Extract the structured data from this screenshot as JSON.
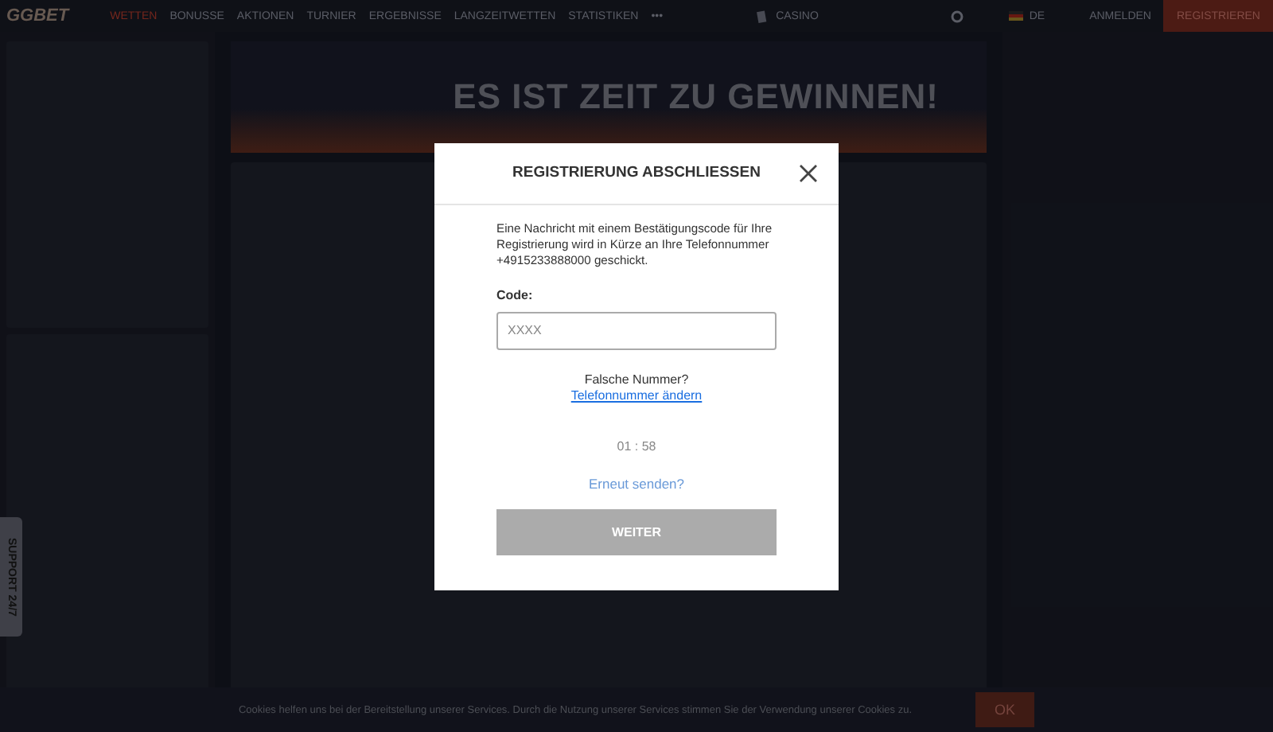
{
  "header": {
    "logo": "GGBET",
    "nav": [
      {
        "label": "WETTEN",
        "selected": true
      },
      {
        "label": "BONUSSE",
        "selected": false
      },
      {
        "label": "AKTIONEN",
        "selected": false
      },
      {
        "label": "TURNIER",
        "selected": false
      },
      {
        "label": "ERGEBNISSE",
        "selected": false
      },
      {
        "label": "LANGZEITWETTEN",
        "selected": false
      },
      {
        "label": "STATISTIKEN",
        "selected": false
      }
    ],
    "more": "•••",
    "casino": "CASINO",
    "language": "DE",
    "login": "ANMELDEN",
    "register": "REGISTRIEREN"
  },
  "banner": {
    "headline": "ES IST ZEIT ZU GEWINNEN!"
  },
  "support": {
    "label": "SUPPORT 24/7"
  },
  "cookie_bar": {
    "text": "Cookies helfen uns bei der Bereitstellung unserer Services. Durch die Nutzung unserer Services stimmen Sie der Verwendung unserer Cookies zu.",
    "ok": "OK"
  },
  "dialog": {
    "title": "REGISTRIERUNG ABSCHLIESSEN",
    "message": "Eine Nachricht mit einem Bestätigungscode für Ihre Registrierung wird in Kürze an Ihre Telefonnummer +4915233888000 geschickt.",
    "code_label": "Code:",
    "code_placeholder": "XXXX",
    "wrong_number": "Falsche Nummer?",
    "change_link": "Telefonnummer ändern",
    "timer": "01 : 58",
    "resend": "Erneut senden?",
    "submit": {
      "label": "WEITER",
      "disabled": true
    }
  }
}
